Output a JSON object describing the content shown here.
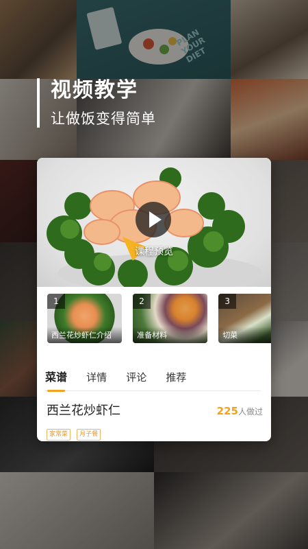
{
  "header": {
    "title": "视频教学",
    "subtitle": "让做饭变得简单"
  },
  "background": {
    "poster_text": "PLAN YOUR DIET"
  },
  "card": {
    "preview_label": "课程预览",
    "steps": [
      {
        "num": "1",
        "label": "西兰花炒虾仁介绍"
      },
      {
        "num": "2",
        "label": "准备材料"
      },
      {
        "num": "3",
        "label": "切菜"
      }
    ],
    "tabs": [
      {
        "label": "菜谱",
        "active": true
      },
      {
        "label": "详情",
        "active": false
      },
      {
        "label": "评论",
        "active": false
      },
      {
        "label": "推荐",
        "active": false
      }
    ],
    "recipe": {
      "name": "西兰花炒虾仁",
      "made_count": "225",
      "made_suffix": "人做过",
      "tags": [
        "家常菜",
        "月子餐"
      ]
    }
  },
  "colors": {
    "accent": "#f4a21e"
  }
}
